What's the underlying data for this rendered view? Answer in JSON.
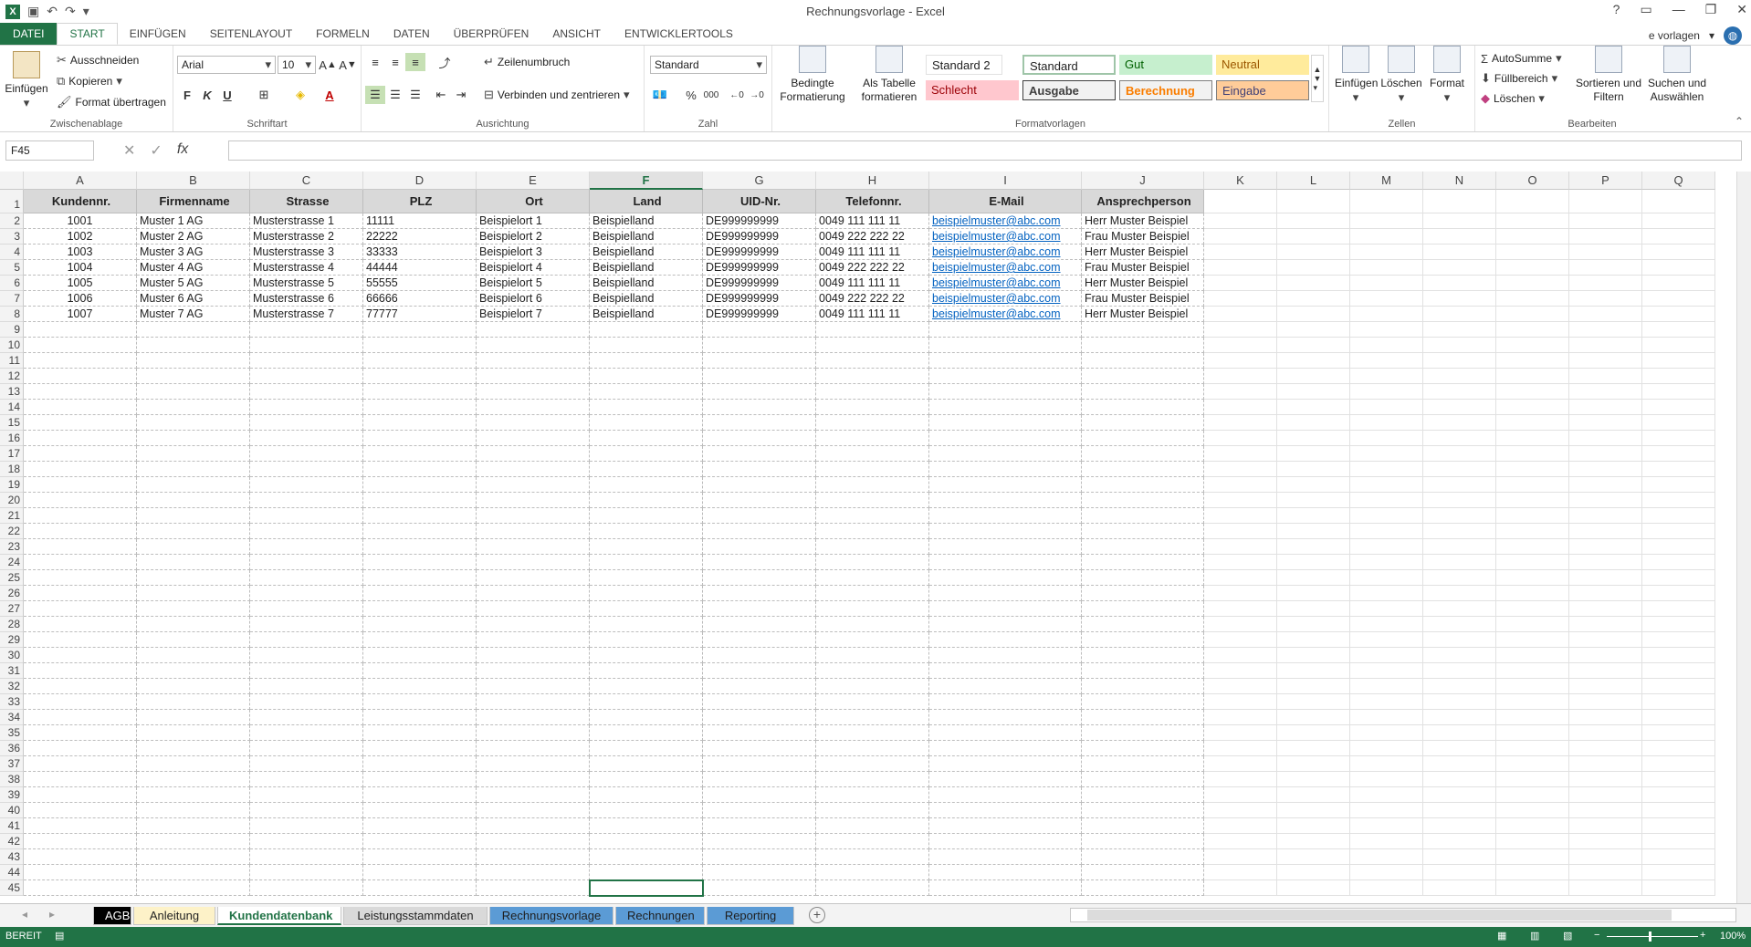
{
  "window": {
    "title": "Rechnungsvorlage - Excel",
    "account": "e vorlagen",
    "app_logo": "X"
  },
  "tabs": [
    {
      "label": "DATEI"
    },
    {
      "label": "START"
    },
    {
      "label": "EINFÜGEN"
    },
    {
      "label": "SEITENLAYOUT"
    },
    {
      "label": "FORMELN"
    },
    {
      "label": "DATEN"
    },
    {
      "label": "ÜBERPRÜFEN"
    },
    {
      "label": "ANSICHT"
    },
    {
      "label": "ENTWICKLERTOOLS"
    }
  ],
  "ribbon": {
    "clipboard": {
      "label": "Zwischenablage",
      "paste": "Einfügen",
      "cut": "Ausschneiden",
      "copy": "Kopieren",
      "format_painter": "Format übertragen"
    },
    "font": {
      "label": "Schriftart",
      "name": "Arial",
      "size": "10",
      "bold": "F",
      "italic": "K",
      "underline": "U"
    },
    "alignment": {
      "label": "Ausrichtung",
      "wrap": "Zeilenumbruch",
      "merge": "Verbinden und zentrieren"
    },
    "number": {
      "label": "Zahl",
      "format": "Standard"
    },
    "styles": {
      "label": "Formatvorlagen",
      "cond_format": "Bedingte Formatierung",
      "as_table": "Als Tabelle formatieren",
      "items": [
        {
          "label": "Standard 2"
        },
        {
          "label": "Standard"
        },
        {
          "label": "Gut"
        },
        {
          "label": "Neutral"
        },
        {
          "label": "Schlecht"
        },
        {
          "label": "Ausgabe"
        },
        {
          "label": "Berechnung"
        },
        {
          "label": "Eingabe"
        }
      ]
    },
    "cells": {
      "label": "Zellen",
      "insert": "Einfügen",
      "delete": "Löschen",
      "format": "Format"
    },
    "editing": {
      "label": "Bearbeiten",
      "autosum": "AutoSumme",
      "fill": "Füllbereich",
      "clear": "Löschen",
      "sort": "Sortieren und Filtern",
      "find": "Suchen und Auswählen"
    }
  },
  "formula_bar": {
    "name_box": "F45",
    "value": ""
  },
  "sheet": {
    "columns": [
      "A",
      "B",
      "C",
      "D",
      "E",
      "F",
      "G",
      "H",
      "I",
      "J",
      "K",
      "L",
      "M",
      "N",
      "O",
      "P",
      "Q"
    ],
    "selected_column": "F",
    "headers": [
      "Kundennr.",
      "Firmenname",
      "Strasse",
      "PLZ",
      "Ort",
      "Land",
      "UID-Nr.",
      "Telefonnr.",
      "E-Mail",
      "Ansprechperson"
    ],
    "rows": [
      [
        "1001",
        "Muster 1 AG",
        "Musterstrasse 1",
        "11111",
        "Beispielort 1",
        "Beispielland",
        "DE999999999",
        "0049 111 111 11",
        "beispielmuster@abc.com",
        "Herr Muster Beispiel"
      ],
      [
        "1002",
        "Muster 2 AG",
        "Musterstrasse 2",
        "22222",
        "Beispielort 2",
        "Beispielland",
        "DE999999999",
        "0049 222 222 22",
        "beispielmuster@abc.com",
        "Frau Muster Beispiel"
      ],
      [
        "1003",
        "Muster 3 AG",
        "Musterstrasse 3",
        "33333",
        "Beispielort 3",
        "Beispielland",
        "DE999999999",
        "0049 111 111 11",
        "beispielmuster@abc.com",
        "Herr Muster Beispiel"
      ],
      [
        "1004",
        "Muster 4 AG",
        "Musterstrasse 4",
        "44444",
        "Beispielort 4",
        "Beispielland",
        "DE999999999",
        "0049 222 222 22",
        "beispielmuster@abc.com",
        "Frau Muster Beispiel"
      ],
      [
        "1005",
        "Muster 5 AG",
        "Musterstrasse 5",
        "55555",
        "Beispielort 5",
        "Beispielland",
        "DE999999999",
        "0049 111 111 11",
        "beispielmuster@abc.com",
        "Herr Muster Beispiel"
      ],
      [
        "1006",
        "Muster 6 AG",
        "Musterstrasse 6",
        "66666",
        "Beispielort 6",
        "Beispielland",
        "DE999999999",
        "0049 222 222 22",
        "beispielmuster@abc.com",
        "Frau Muster Beispiel"
      ],
      [
        "1007",
        "Muster 7 AG",
        "Musterstrasse 7",
        "77777",
        "Beispielort 7",
        "Beispielland",
        "DE999999999",
        "0049 111 111 11",
        "beispielmuster@abc.com",
        "Herr Muster Beispiel"
      ]
    ],
    "row_count": 45
  },
  "sheet_tabs": [
    {
      "label": "AGB",
      "bg": "#000000",
      "fg": "#ffffff"
    },
    {
      "label": "Anleitung",
      "bg": "#fdf2c8",
      "fg": "#222222"
    },
    {
      "label": "Kundendatenbank",
      "bg": "#ffffff",
      "fg": "#217346",
      "active": true
    },
    {
      "label": "Leistungsstammdaten",
      "bg": "#d9d9d9",
      "fg": "#222222"
    },
    {
      "label": "Rechnungsvorlage",
      "bg": "#5b9bd5",
      "fg": "#1f1f1f"
    },
    {
      "label": "Rechnungen",
      "bg": "#5b9bd5",
      "fg": "#1f1f1f"
    },
    {
      "label": "Reporting",
      "bg": "#5b9bd5",
      "fg": "#1f1f1f"
    }
  ],
  "status": {
    "mode": "BEREIT",
    "zoom": "100%"
  },
  "colors": {
    "accent": "#217346",
    "header_fill": "#d9d9d9",
    "link": "#0563c1"
  }
}
